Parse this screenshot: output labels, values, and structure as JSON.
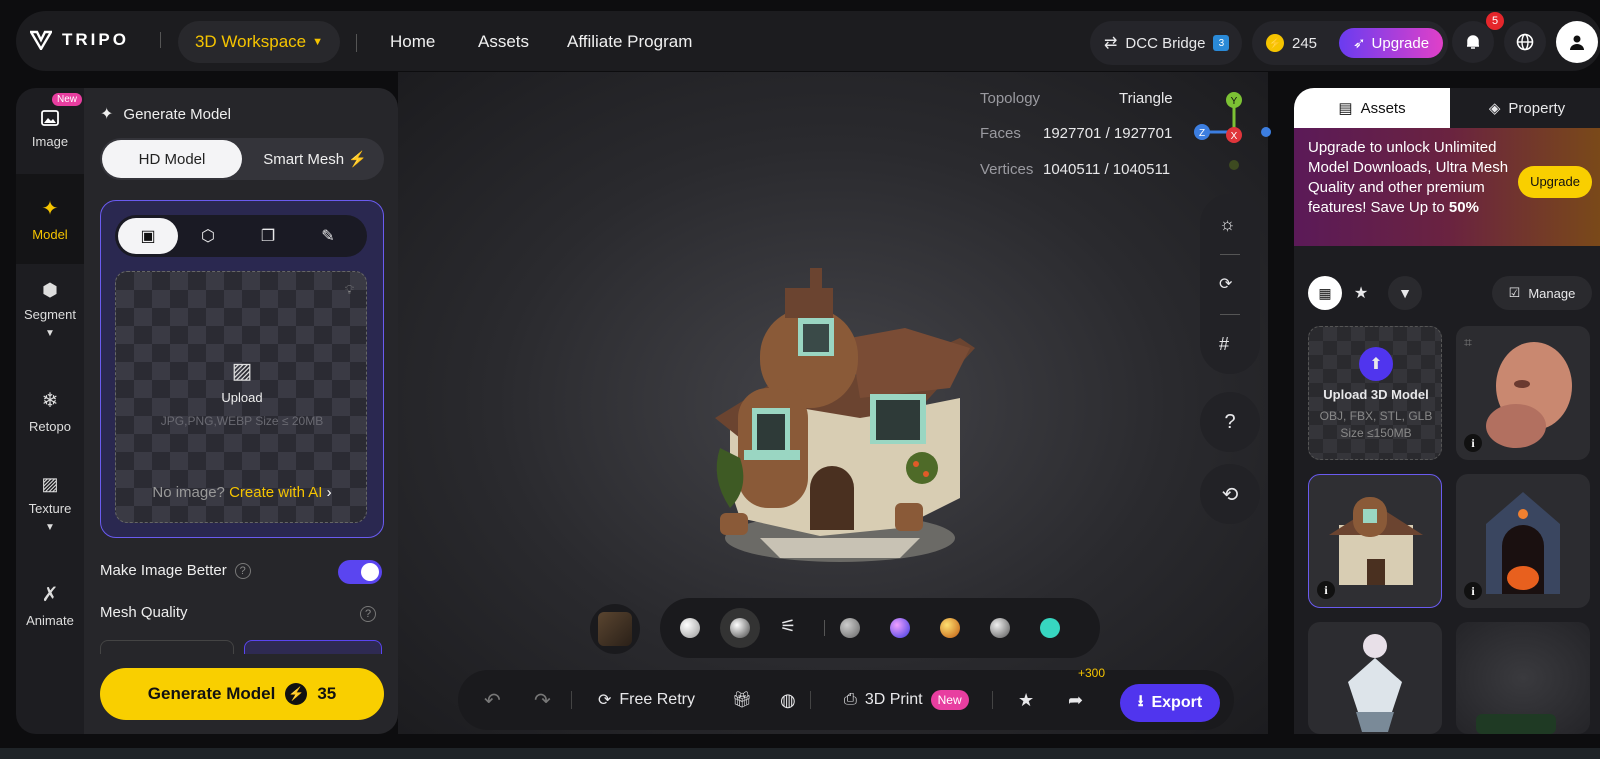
{
  "topbar": {
    "logo_text": "TRIPO",
    "workspace_label": "3D Workspace",
    "nav": [
      "Home",
      "Assets",
      "Affiliate Program"
    ],
    "dcc_label": "DCC Bridge",
    "credits": "245",
    "upgrade_label": "Upgrade",
    "notification_count": "5"
  },
  "sidebar": {
    "items": [
      {
        "label": "Image",
        "icon": "image-icon",
        "tag": "New"
      },
      {
        "label": "Model",
        "icon": "sparkle-icon"
      },
      {
        "label": "Segment",
        "icon": "cube-split-icon"
      },
      {
        "label": "Retopo",
        "icon": "mesh-icon"
      },
      {
        "label": "Texture",
        "icon": "texture-icon"
      },
      {
        "label": "Animate",
        "icon": "figure-icon"
      }
    ]
  },
  "panel": {
    "title": "Generate Model",
    "mode_tabs": [
      "HD Model",
      "Smart Mesh"
    ],
    "upload_label": "Upload",
    "upload_hint": "JPG,PNG,WEBP Size ≤ 20MB",
    "no_image": "No image?",
    "create_ai": "Create with AI",
    "make_better": "Make Image Better",
    "make_better_on": true,
    "mesh_quality": "Mesh Quality",
    "generate_label": "Generate Model",
    "generate_cost": "35"
  },
  "viewport": {
    "topology_label": "Topology",
    "topology_value": "Triangle",
    "faces_label": "Faces",
    "faces_value": "1927701 / 1927701",
    "vertices_label": "Vertices",
    "vertices_value": "1040511 / 1040511",
    "axes": [
      "Y",
      "Z",
      "X"
    ]
  },
  "bottombar": {
    "free_retry": "Free Retry",
    "print": "3D Print",
    "print_tag": "New",
    "share_bonus": "+300",
    "export": "Export"
  },
  "material_colors": [
    "#d8d8d8",
    "#888888",
    "#7a5cff",
    "#e88a1e",
    "#9a9a9a",
    "#37d6c0"
  ],
  "right": {
    "tabs": [
      "Assets",
      "Property"
    ],
    "promo_text": "Upgrade to unlock Unlimited Model Downloads, Ultra Mesh Quality and other premium features!  Save Up to ",
    "promo_pct": "50%",
    "promo_btn": "Upgrade",
    "manage": "Manage",
    "upload_title": "Upload 3D Model",
    "upload_formats": "OBJ, FBX, STL, GLB",
    "upload_size": "Size ≤150MB"
  }
}
